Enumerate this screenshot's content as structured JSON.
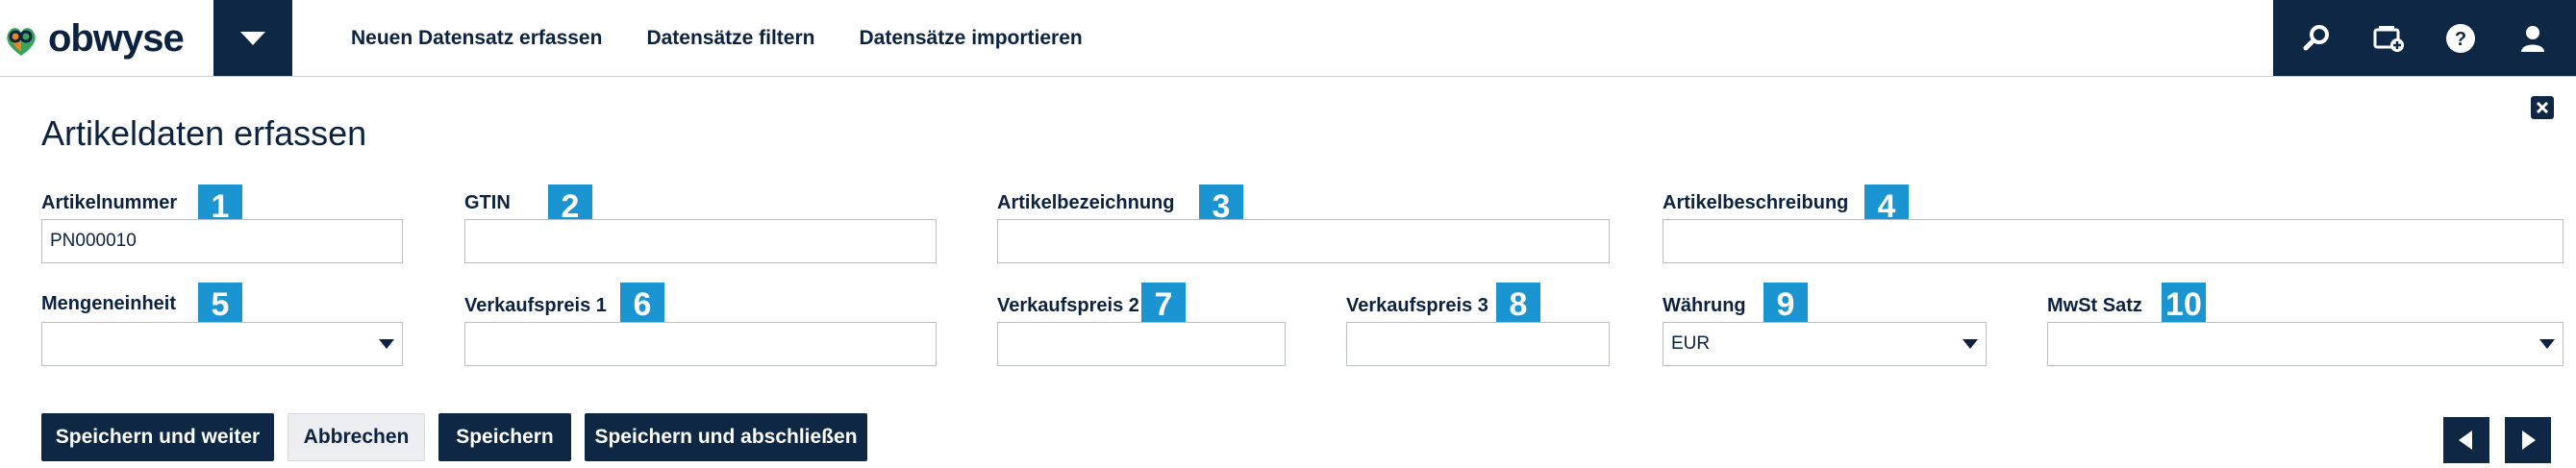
{
  "brand": {
    "name": "obwyse",
    "colors": {
      "navy": "#0d2745",
      "badge": "#1a95d1",
      "logo_orange": "#e8862a",
      "logo_green": "#3aa35b"
    }
  },
  "nav": {
    "menu_icon": "chevron-down-icon",
    "links": [
      "Neuen Datensatz erfassen",
      "Datensätze filtern",
      "Datensätze importieren"
    ],
    "right_icons": [
      "search-icon",
      "add-card-icon",
      "help-icon",
      "user-icon"
    ]
  },
  "form": {
    "title": "Artikeldaten erfassen",
    "close_icon": "close-icon",
    "fields": {
      "artikelnummer": {
        "label": "Artikelnummer",
        "badge": "1",
        "value": "PN000010"
      },
      "gtin": {
        "label": "GTIN",
        "badge": "2",
        "value": ""
      },
      "artikelbezeichnung": {
        "label": "Artikelbezeichnung",
        "badge": "3",
        "value": ""
      },
      "artikelbeschreibung": {
        "label": "Artikelbeschreibung",
        "badge": "4",
        "value": ""
      },
      "mengeneinheit": {
        "label": "Mengeneinheit",
        "badge": "5",
        "value": ""
      },
      "verkaufspreis1": {
        "label": "Verkaufspreis 1",
        "badge": "6",
        "value": ""
      },
      "verkaufspreis2": {
        "label": "Verkaufspreis 2",
        "badge": "7",
        "value": ""
      },
      "verkaufspreis3": {
        "label": "Verkaufspreis 3",
        "badge": "8",
        "value": ""
      },
      "waehrung": {
        "label": "Währung",
        "badge": "9",
        "value": "EUR"
      },
      "mwst": {
        "label": "MwSt Satz",
        "badge": "10",
        "value": ""
      }
    },
    "buttons": {
      "save_continue": "Speichern und weiter",
      "cancel": "Abbrechen",
      "save": "Speichern",
      "save_close": "Speichern und abschließen"
    },
    "pager": {
      "prev_icon": "triangle-left-icon",
      "next_icon": "triangle-right-icon"
    }
  }
}
